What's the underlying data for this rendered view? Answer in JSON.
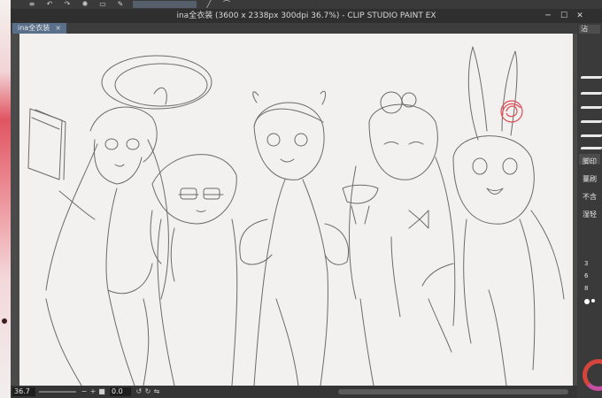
{
  "window": {
    "title": "ina全衣装 (3600 x 2338px 300dpi 36.7%)  - CLIP STUDIO PAINT EX"
  },
  "tabs": [
    {
      "label": "ina全衣装"
    }
  ],
  "status": {
    "zoom": "36.7",
    "angle": "0.0"
  },
  "right_panel": {
    "tab_label": "沾",
    "labels": [
      "脚印",
      "薹刷",
      "不含",
      "湿轻"
    ],
    "numbers": [
      "3",
      "6",
      "8"
    ]
  },
  "icons": {
    "minimize": "minimize-icon",
    "maximize": "maximize-icon",
    "close": "close-icon",
    "undo": "undo-icon",
    "redo": "redo-icon"
  },
  "colors": {
    "canvas_bg": "#f2f1ef",
    "tab_active": "#5a6f8a",
    "sketch_stroke": "#6b6b6b",
    "accent_red": "#e24a55"
  }
}
